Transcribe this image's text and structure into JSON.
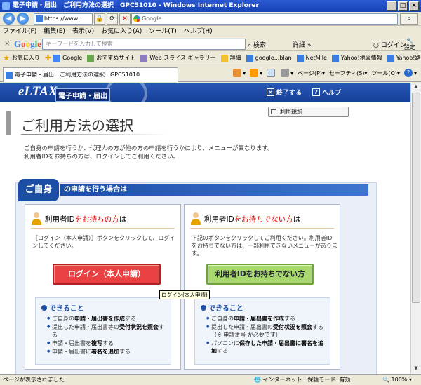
{
  "window": {
    "title": "電子申請・届出　ご利用方法の選択　GPC51010 - Windows Internet Explorer"
  },
  "addressbar": {
    "url": "https://www...",
    "search_placeholder": "Google"
  },
  "menubar": [
    "ファイル(F)",
    "編集(E)",
    "表示(V)",
    "お気に入り(A)",
    "ツール(T)",
    "ヘルプ(H)"
  ],
  "googlebar": {
    "close": "×",
    "keyword_placeholder": "キーワードを入力して検索",
    "search_label": "検索",
    "details_label": "詳細",
    "login_label": "ログイン",
    "settings_label": "設定"
  },
  "favorites": {
    "favorites_label": "お気に入り",
    "items": [
      "Google",
      "おすすめサイト",
      "Web スライス ギャラリー",
      "詳細",
      "google...blan",
      "NetMile",
      "Yahoo!地図情報",
      "Yahoo!路線情報"
    ]
  },
  "tab": {
    "title": "電子申請・届出　ご利用方法の選択　GPC51010"
  },
  "tools": {
    "page_label": "ページ(P)",
    "safety_label": "セーフティ(S)",
    "tools_label": "ツール(O)",
    "help_label": "?"
  },
  "page": {
    "logo": "eLTAX",
    "logo_sub": "電子申請・届出",
    "exit_label": "終了する",
    "help_label": "ヘルプ",
    "terms_label": "利用規約",
    "title": "ご利用方法の選択",
    "intro_line1": "ご自身の申請を行うか、代理人の方が他の方の申請を行うかにより、メニューが異なります。",
    "intro_line2": "利用者IDをお持ちの方は、ログインしてご利用ください。",
    "section_badge": "ご自身",
    "section_title": "の申請を行う場合は",
    "card_left": {
      "title_pre": "利用者ID",
      "title_mid": "をお持ちの方",
      "title_post": "は",
      "desc": "［ログイン（本人申請）］ボタンをクリックして、ログインしてください。",
      "button": "ログイン（本人申請）",
      "tooltip": "ログイン(本人申請)",
      "can_title": "できること",
      "can_items": [
        {
          "pre": "ご自身の",
          "bold": "申請・届出書を作成",
          "post": "する"
        },
        {
          "pre": "提出した申請・届出書等の",
          "bold": "受付状況を照会",
          "post": "する"
        },
        {
          "pre": "申請・届出書を",
          "bold": "複写",
          "post": "する"
        },
        {
          "pre": "申請・届出書に",
          "bold": "署名を追加",
          "post": "する"
        }
      ]
    },
    "card_right": {
      "title_pre": "利用者ID",
      "title_mid": "をお持ちでない方",
      "title_post": "は",
      "desc": "下記のボタンをクリックしてご利用ください。利用者IDをお持ちでない方は、一部利用できないメニューがあります。",
      "button": "利用者IDをお持ちでない方",
      "can_title": "できること",
      "can_items": [
        {
          "pre": "ご自身の",
          "bold": "申請・届出書を作成",
          "post": "する"
        },
        {
          "pre": "提出した申請・届出書の",
          "bold": "受付状況を照会",
          "post": "する（※ 申請番号 が必要です）"
        },
        {
          "pre": "パソコンに",
          "bold": "保存した申請・届出書に署名を追加",
          "post": "する"
        }
      ]
    }
  },
  "status": {
    "left": "ページが表示されました",
    "zone": "インターネット | 保護モード: 有効",
    "zoom": "100%"
  }
}
